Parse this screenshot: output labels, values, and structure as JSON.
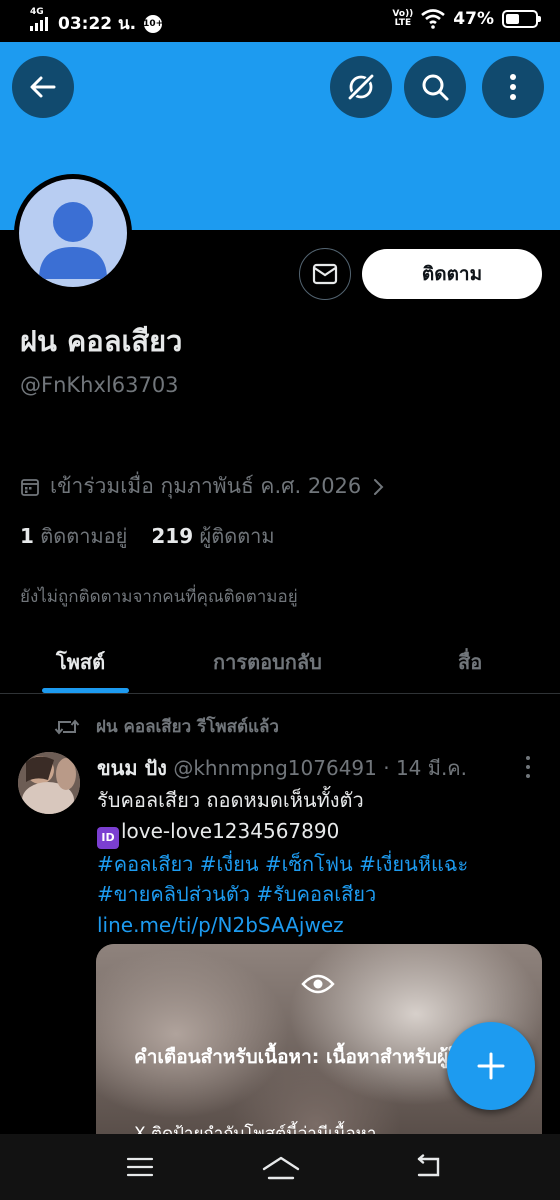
{
  "status_bar": {
    "network": "4G",
    "time": "03:22 น.",
    "notification_badge": "10+",
    "volte_top": "Vo))",
    "volte_bottom": "LTE",
    "battery": "47%",
    "battery_level": 0.47
  },
  "header": {
    "back_icon": "arrow-left-icon",
    "grok_icon": "grok-icon",
    "search_icon": "search-icon",
    "more_icon": "more-vertical-icon"
  },
  "profile": {
    "display_name": "ฝน คอลเสียว",
    "handle": "@FnKhxl63703",
    "joined": "เข้าร่วมเมื่อ กุมภาพันธ์ ค.ศ. 2026",
    "following_count": "1",
    "following_label": "ติดตามอยู่",
    "followers_count": "219",
    "followers_label": "ผู้ติดตาม",
    "not_followed_note": "ยังไม่ถูกติดตามจากคนที่คุณติดตามอยู่",
    "follow_button": "ติดตาม"
  },
  "tabs": [
    {
      "label": "โพสต์",
      "active": true
    },
    {
      "label": "การตอบกลับ",
      "active": false
    },
    {
      "label": "สื่อ",
      "active": false
    }
  ],
  "post": {
    "repost_label": "ฝน คอลเสียว รีโพสต์แล้ว",
    "author_name": "ขนม ปัง",
    "author_handle": "@khnmpng1076491",
    "separator": "·",
    "date": "14 มี.ค.",
    "line1": "รับคอลเสียว  ถอดหมดเห็นทั้งตัว",
    "id_badge": "ID",
    "line2": "love-love1234567890",
    "hashtags_1": "#คอลเสียว #เงี่ยน #เซ็กโฟน #เงี่ยนหีแฉะ",
    "hashtags_2": "#ขายคลิปส่วนตัว #รับคอลเสียว",
    "link": "line.me/ti/p/N2bSAAjwez",
    "media_warning": "คำเตือนสำหรับเนื้อหา: เนื้อหาสำหรับผู้ใหญ่",
    "media_sub": "X ติดป้ายกำกับโพสต์นี้ว่ามีเนื้อหา"
  },
  "colors": {
    "accent": "#1d9bf0",
    "banner": "#1d9bf0",
    "header_button": "#114a6e",
    "secondary_text": "#71767b"
  }
}
